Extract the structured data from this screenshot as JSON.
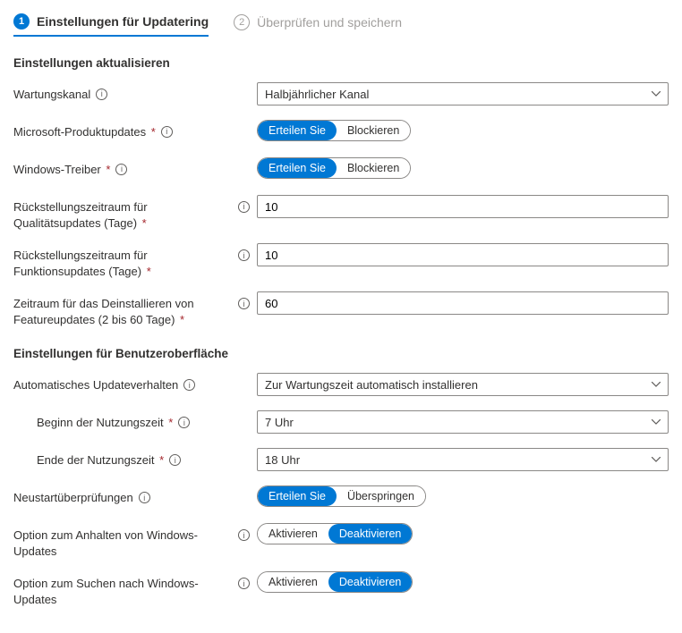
{
  "tabs": {
    "step1_num": "1",
    "step1_label": "Einstellungen für Updatering",
    "step2_num": "2",
    "step2_label": "Überprüfen und speichern"
  },
  "section1": {
    "heading": "Einstellungen aktualisieren",
    "servicing_channel_label": "Wartungskanal",
    "servicing_channel_value": "Halbjährlicher Kanal",
    "product_updates_label": "Microsoft-Produktupdates",
    "product_updates_opt1": "Erteilen Sie",
    "product_updates_opt2": "Blockieren",
    "drivers_label": "Windows-Treiber",
    "drivers_opt1": "Erteilen Sie",
    "drivers_opt2": "Blockieren",
    "quality_deferral_label": "Rückstellungszeitraum für Qualitätsupdates (Tage)",
    "quality_deferral_value": "10",
    "feature_deferral_label": "Rückstellungszeitraum für Funktionsupdates (Tage)",
    "feature_deferral_value": "10",
    "uninstall_period_label": "Zeitraum für das Deinstallieren von Featureupdates (2 bis 60 Tage)",
    "uninstall_period_value": "60"
  },
  "section2": {
    "heading": "Einstellungen für Benutzeroberfläche",
    "auto_behavior_label": "Automatisches Updateverhalten",
    "auto_behavior_value": "Zur Wartungszeit automatisch installieren",
    "active_start_label": "Beginn der Nutzungszeit",
    "active_start_value": "7 Uhr",
    "active_end_label": "Ende der Nutzungszeit",
    "active_end_value": "18 Uhr",
    "restart_checks_label": "Neustartüberprüfungen",
    "restart_checks_opt1": "Erteilen Sie",
    "restart_checks_opt2": "Überspringen",
    "pause_label": "Option zum Anhalten von Windows-Updates",
    "pause_opt1": "Aktivieren",
    "pause_opt2": "Deaktivieren",
    "check_label": "Option zum Suchen nach Windows-Updates",
    "check_opt1": "Aktivieren",
    "check_opt2": "Deaktivieren"
  }
}
